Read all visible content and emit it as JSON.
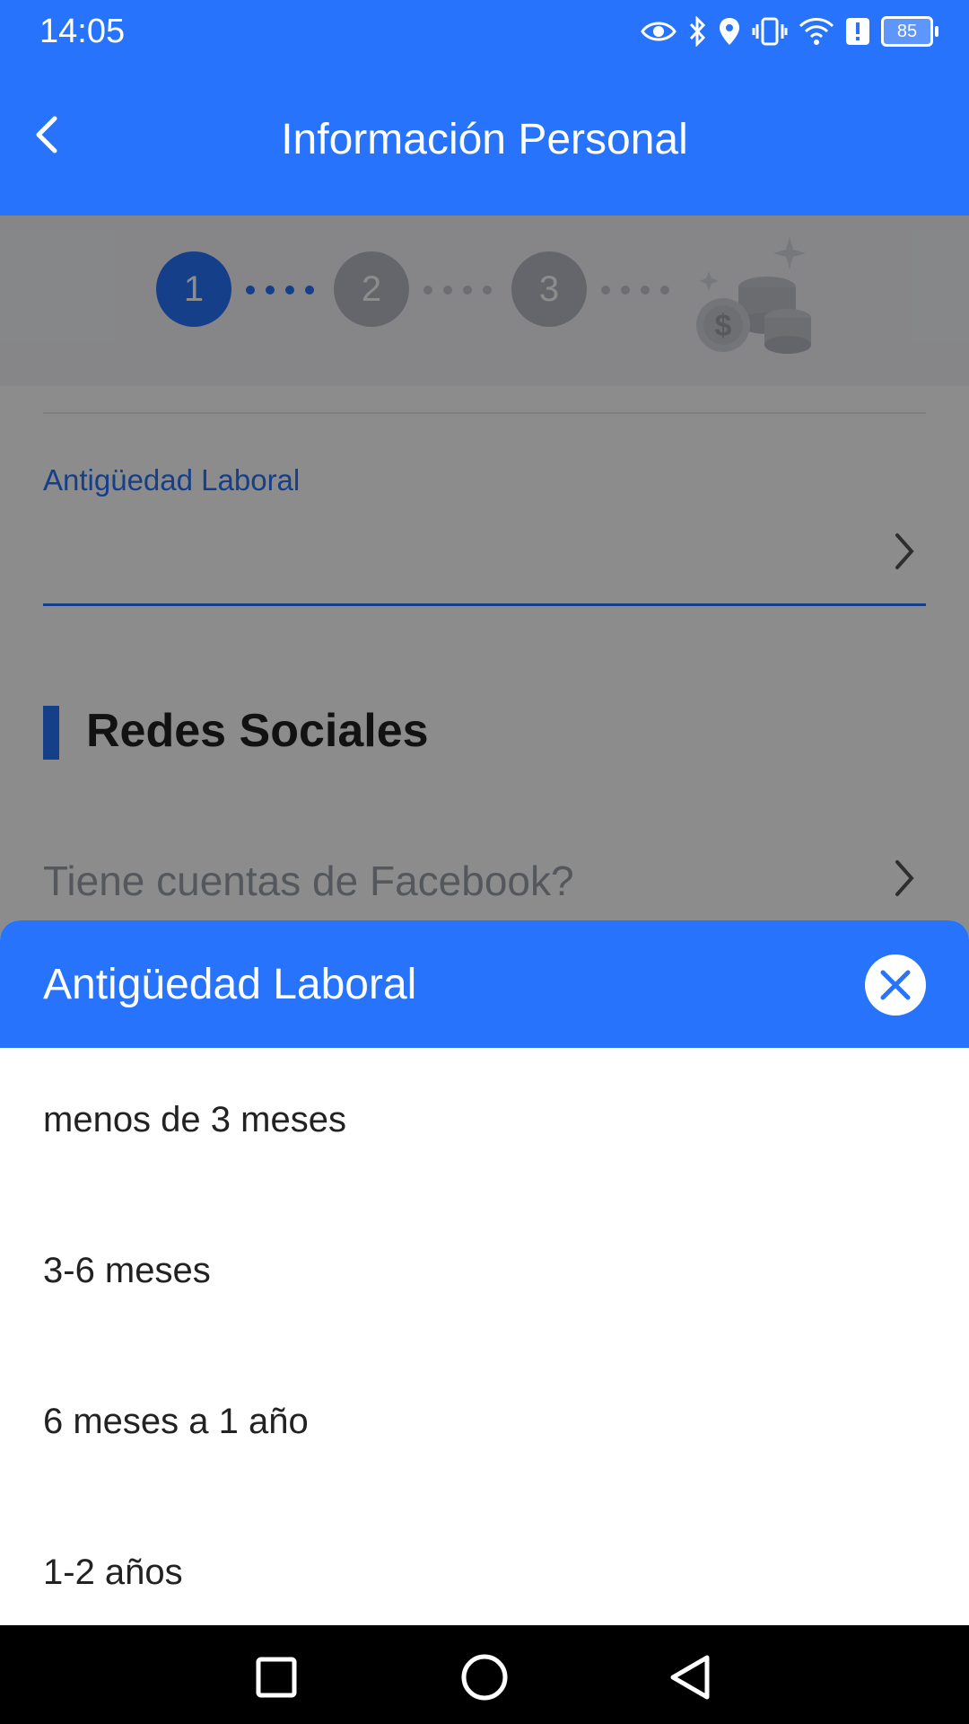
{
  "status_bar": {
    "time": "14:05",
    "battery_level": "85",
    "icons": [
      "eye-icon",
      "bluetooth-icon",
      "location-icon",
      "vibrate-icon",
      "wifi-icon",
      "alert-icon",
      "battery-icon"
    ]
  },
  "header": {
    "title": "Información Personal",
    "back_icon": "chevron-left-icon"
  },
  "stepper": {
    "steps": [
      "1",
      "2",
      "3"
    ],
    "active_step": 1,
    "reward_icon": "coins-icon"
  },
  "form": {
    "work_seniority_label": "Antigüedad Laboral",
    "section_title": "Redes Sociales",
    "facebook_question": "Tiene cuentas de Facebook?"
  },
  "picker": {
    "title": "Antigüedad Laboral",
    "options": [
      "menos de 3 meses",
      "3-6 meses",
      "6 meses a 1 año",
      "1-2 años"
    ]
  },
  "colors": {
    "primary": "#2873fb",
    "text": "#222222",
    "placeholder": "#9aa0aa"
  }
}
